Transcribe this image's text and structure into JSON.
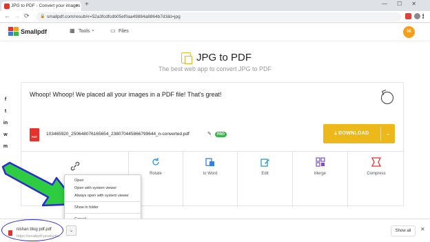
{
  "browser": {
    "tab_title": "JPG to PDF - Convert your images",
    "tab_close": "×",
    "new_tab": "+",
    "window_controls": "—☐✕",
    "url": "smallpdf.com/result#r=52a3fcdfcdb05ef0aa49884a8864b7d3&t=jpg",
    "nav_back": "←",
    "nav_forward": "→",
    "nav_reload": "⟳",
    "lock": "🔒"
  },
  "header": {
    "logo_text": "Smallpdf",
    "tools_label": "Tools",
    "tools_chevron": "⌄",
    "files_label": "Files",
    "avatar_initials": "NI"
  },
  "hero": {
    "title": "JPG to PDF",
    "subtitle": "The best web app to convert JPG to PDF"
  },
  "result": {
    "message": "Whoop! Whoop! We placed all your images in a PDF file! That's great!",
    "file_name": "103465920_250648076165654_238070445866799644_n-converted.pdf",
    "pencil": "✎",
    "pro_badge": "PRO",
    "download_label": "DOWNLOAD",
    "download_caret": "⌄"
  },
  "tools": [
    {
      "label": "",
      "icon": "link-icon"
    },
    {
      "label": "Rotate",
      "icon": "rotate-icon"
    },
    {
      "label": "to Word",
      "icon": "word-icon"
    },
    {
      "label": "Edit",
      "icon": "edit-icon"
    },
    {
      "label": "Merge",
      "icon": "merge-icon"
    },
    {
      "label": "Compress",
      "icon": "compress-icon"
    }
  ],
  "share": [
    "f",
    "t",
    "in",
    "w",
    "m"
  ],
  "context_menu": {
    "open": "Open",
    "open_system": "Open with system viewer",
    "always_open_system": "Always open with system viewer",
    "show_in_folder": "Show in folder",
    "cancel": "Cancel"
  },
  "download_shelf": {
    "file_name": "nishan blog pdf.pdf",
    "file_url": "https://smallpdf-productio...",
    "menu_caret": "⌄",
    "show_all": "Show all",
    "close": "✕"
  },
  "colors": {
    "brand_red": "#e5322d",
    "download_yellow": "#ecb81a",
    "avatar_orange": "#f59f1c",
    "pro_green": "#39b54a",
    "annotation_arrow": "#2a2ad8",
    "annotation_fill": "#2ecc40"
  }
}
